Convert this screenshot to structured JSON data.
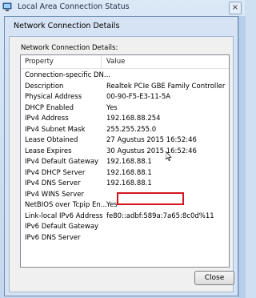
{
  "parent_window": {
    "title": "Local Area Connection Status",
    "close_glyph": "×"
  },
  "dialog": {
    "title": "Network Connection Details"
  },
  "section_label": "Network Connection Details:",
  "columns": {
    "property": "Property",
    "value": "Value"
  },
  "rows": [
    {
      "property": "Connection-specific DN...",
      "value": ""
    },
    {
      "property": "Description",
      "value": "Realtek PCIe GBE Family Controller"
    },
    {
      "property": "Physical Address",
      "value": "00-90-F5-E3-11-5A"
    },
    {
      "property": "DHCP Enabled",
      "value": "Yes"
    },
    {
      "property": "IPv4 Address",
      "value": "192.168.88.254"
    },
    {
      "property": "IPv4 Subnet Mask",
      "value": "255.255.255.0"
    },
    {
      "property": "Lease Obtained",
      "value": "27 Agustus 2015 16:52:46"
    },
    {
      "property": "Lease Expires",
      "value": "30 Agustus 2015 16:52:46"
    },
    {
      "property": "IPv4 Default Gateway",
      "value": "192.168.88.1"
    },
    {
      "property": "IPv4 DHCP Server",
      "value": "192.168.88.1"
    },
    {
      "property": "IPv4 DNS Server",
      "value": "192.168.88.1"
    },
    {
      "property": "IPv4 WINS Server",
      "value": ""
    },
    {
      "property": "NetBIOS over Tcpip En...",
      "value": "Yes"
    },
    {
      "property": "Link-local IPv6 Address",
      "value": "fe80::adbf:589a:7a65:8c0d%11"
    },
    {
      "property": "IPv6 Default Gateway",
      "value": ""
    },
    {
      "property": "IPv6 DNS Server",
      "value": ""
    }
  ],
  "highlight_color": "#d4151f",
  "buttons": {
    "close": "Close"
  }
}
